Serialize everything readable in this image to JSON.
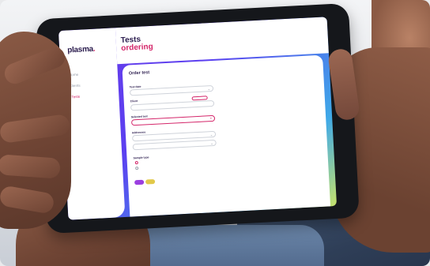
{
  "app": {
    "logo": "plasma",
    "breadcrumb": "",
    "title_line1": "Tests",
    "title_line2": "ordering"
  },
  "sidebar": {
    "items": [
      {
        "label": "Home"
      },
      {
        "label": "Clients"
      },
      {
        "label": "Tests"
      },
      {
        "label": ""
      },
      {
        "label": ""
      }
    ],
    "active_index": 2,
    "footer": [
      {
        "label": ""
      },
      {
        "label": ""
      }
    ]
  },
  "form": {
    "title": "Order test",
    "fields": [
      {
        "label": "Test date",
        "value": ""
      },
      {
        "label": "Client",
        "value": ""
      },
      {
        "label": "Selected test",
        "value": ""
      },
      {
        "label": "Addresses",
        "value": ""
      }
    ],
    "second_address_value": "",
    "sample_type_label": "Sample type",
    "sample_type_options": [
      {
        "label": "",
        "selected": true
      },
      {
        "label": "",
        "selected": false
      }
    ],
    "required_label": "",
    "chips": [
      "",
      ""
    ]
  },
  "colors": {
    "accent": "#d4266a",
    "brand_dark": "#2a1b4d",
    "gradient_start": "#6a3de8",
    "gradient_end": "#c8e36a"
  }
}
